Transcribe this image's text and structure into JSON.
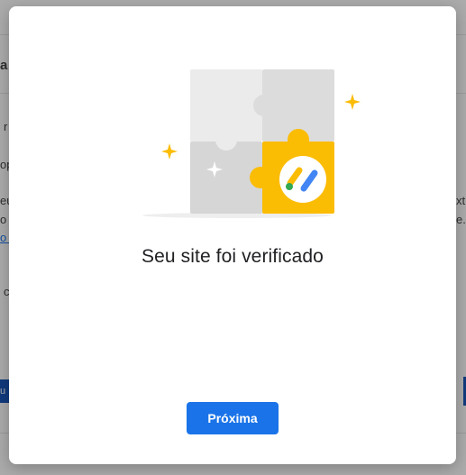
{
  "background": {
    "fragments": [
      "a",
      "r",
      "op",
      "eu",
      "o",
      "o c",
      "c",
      "u",
      "xt",
      "e."
    ]
  },
  "dialog": {
    "title": "Seu site foi verificado",
    "next_button": "Próxima"
  },
  "colors": {
    "primary": "#1a73e8",
    "puzzle_yellow": "#fbbc04",
    "puzzle_gray": "#e8e8e8",
    "sparkle": "#fbbc04",
    "logo_green": "#34a853",
    "logo_yellow": "#fbbc04",
    "logo_blue": "#4285f4"
  },
  "icons": {
    "illustration": "puzzle-verified-illustration",
    "logo": "adsense-logo-icon"
  }
}
